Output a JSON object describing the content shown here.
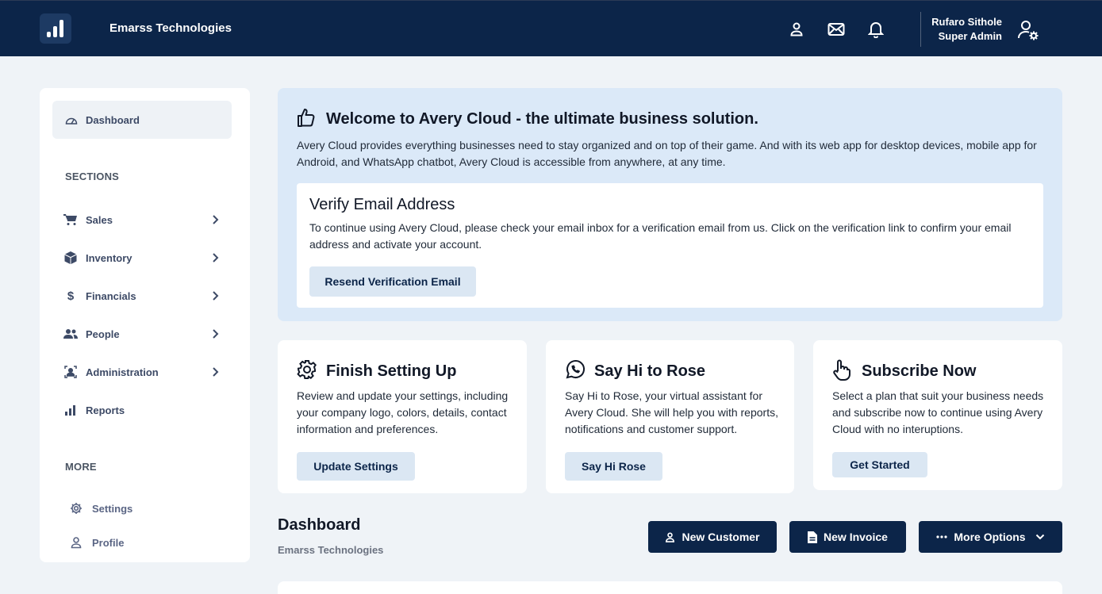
{
  "header": {
    "company": "Emarss Technologies",
    "user_name": "Rufaro Sithole",
    "user_role": "Super Admin"
  },
  "sidebar": {
    "dashboard_label": "Dashboard",
    "sections_title": "SECTIONS",
    "items": [
      {
        "label": "Sales",
        "icon": "cart-icon"
      },
      {
        "label": "Inventory",
        "icon": "box-icon"
      },
      {
        "label": "Financials",
        "icon": "dollar-icon"
      },
      {
        "label": "People",
        "icon": "people-icon"
      },
      {
        "label": "Administration",
        "icon": "id-badge-icon"
      },
      {
        "label": "Reports",
        "icon": "bar-chart-icon"
      }
    ],
    "more_title": "MORE",
    "more_items": [
      {
        "label": "Settings",
        "icon": "gear-icon"
      },
      {
        "label": "Profile",
        "icon": "user-icon"
      }
    ]
  },
  "welcome": {
    "title": "Welcome to Avery Cloud - the ultimate business solution.",
    "text": "Avery Cloud provides everything businesses need to stay organized and on top of their game. And with its web app for desktop devices, mobile app for Android, and WhatsApp chatbot, Avery Cloud is accessible from anywhere, at any time.",
    "verify_title": "Verify Email Address",
    "verify_text": "To continue using Avery Cloud, please check your email inbox for a verification email from us. Click on the verification link to confirm your email address and activate your account.",
    "verify_button": "Resend Verification Email"
  },
  "cards": [
    {
      "title": "Finish Setting Up",
      "text": "Review and update your settings, including your company logo, colors, details, contact information and preferences.",
      "button": "Update Settings"
    },
    {
      "title": "Say Hi to Rose",
      "text": "Say Hi to Rose, your virtual assistant for Avery Cloud. She will help you with reports, notifications and customer support.",
      "button": "Say Hi Rose"
    },
    {
      "title": "Subscribe Now",
      "text": "Select a plan that suit your business needs and subscribe now to continue using Avery Cloud with no interuptions.",
      "button": "Get Started"
    }
  ],
  "dashboard": {
    "title": "Dashboard",
    "subtitle": "Emarss Technologies",
    "new_customer": "New Customer",
    "new_invoice": "New Invoice",
    "more_options": "More Options"
  },
  "colors": {
    "navy": "#0c2549",
    "page_bg": "#eff3f7",
    "banner_bg": "#dbe9f8",
    "button_light": "#dbe7f3"
  }
}
